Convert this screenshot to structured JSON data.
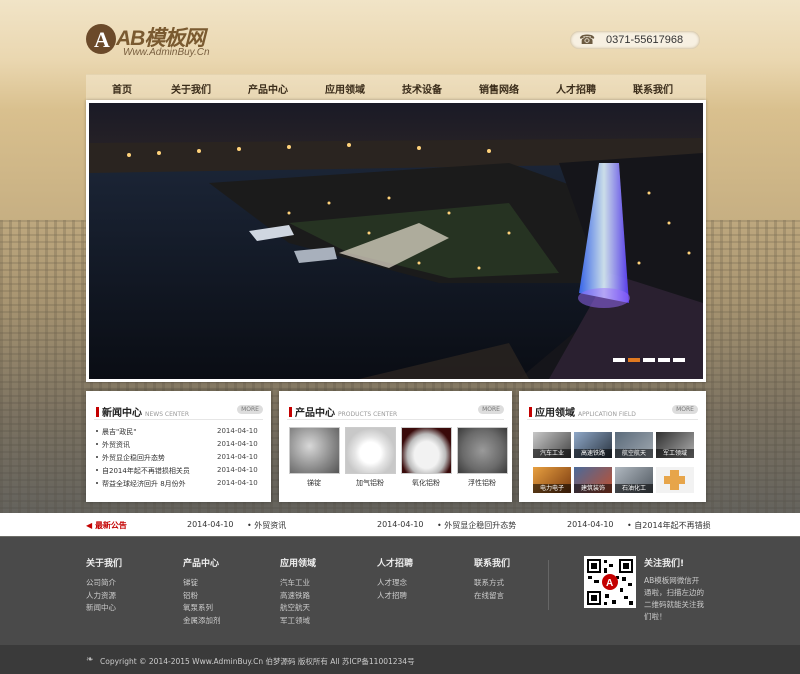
{
  "logo": {
    "mark": "A",
    "name": "AB模板网",
    "url": "Www.AdminBuy.Cn"
  },
  "phone": {
    "number": "0371-55617968"
  },
  "nav": [
    "首页",
    "关于我们",
    "产品中心",
    "应用领域",
    "技术设备",
    "销售网络",
    "人才招聘",
    "联系我们"
  ],
  "news": {
    "title": "新闻中心",
    "subtitle": "NEWS CENTER",
    "more": "MORE",
    "items": [
      {
        "title": "晨吉\"政民\"",
        "date": "2014-04-10"
      },
      {
        "title": "外贸资讯",
        "date": "2014-04-10"
      },
      {
        "title": "外贸显企稳回升态势",
        "date": "2014-04-10"
      },
      {
        "title": "自2014年起不再错损相关员",
        "date": "2014-04-10"
      },
      {
        "title": "帮益全球经济回升 8月份外",
        "date": "2014-04-10"
      }
    ]
  },
  "products": {
    "title": "产品中心",
    "subtitle": "PRODUCTS CENTER",
    "more": "MORE",
    "items": [
      "锑锭",
      "加气铝粉",
      "氧化铝粉",
      "浮性铝粉"
    ]
  },
  "applications": {
    "title": "应用领域",
    "subtitle": "APPLICATION FIELD",
    "more": "MORE",
    "items": [
      "汽车工业",
      "高速铁路",
      "航空航天",
      "军工领域",
      "电力电子",
      "建筑装饰",
      "石油化工",
      ""
    ]
  },
  "notice": {
    "title": "最新公告",
    "items": [
      {
        "date": "2014-04-10",
        "title": "外贸资讯"
      },
      {
        "date": "2014-04-10",
        "title": "外贸显企稳回升态势"
      },
      {
        "date": "2014-04-10",
        "title": "自2014年起不再错损"
      }
    ]
  },
  "footer": {
    "columns": [
      {
        "title": "关于我们",
        "links": [
          "公司简介",
          "人力资源",
          "新闻中心"
        ]
      },
      {
        "title": "产品中心",
        "links": [
          "锑锭",
          "铝粉",
          "氧泵系列",
          "金属添加剂"
        ]
      },
      {
        "title": "应用领域",
        "links": [
          "汽车工业",
          "高速铁路",
          "航空航天",
          "军工领域"
        ]
      },
      {
        "title": "人才招聘",
        "links": [
          "人才理念",
          "人才招聘"
        ]
      },
      {
        "title": "联系我们",
        "links": [
          "联系方式",
          "在线留言"
        ]
      }
    ],
    "follow_title": "关注我们!",
    "follow_text": "AB模板网微信开通啦，扫描左边的二维码就能关注我们啦！"
  },
  "copyright": "Copyright © 2014-2015 Www.AdminBuy.Cn 伯梦源码 版权所有  All  苏ICP备11001234号",
  "colors": {
    "accent_red": "#c40000",
    "brand_brown": "#6b4a2a",
    "slider_active": "#e07a20",
    "footer_bg": "#4a4a4a"
  }
}
